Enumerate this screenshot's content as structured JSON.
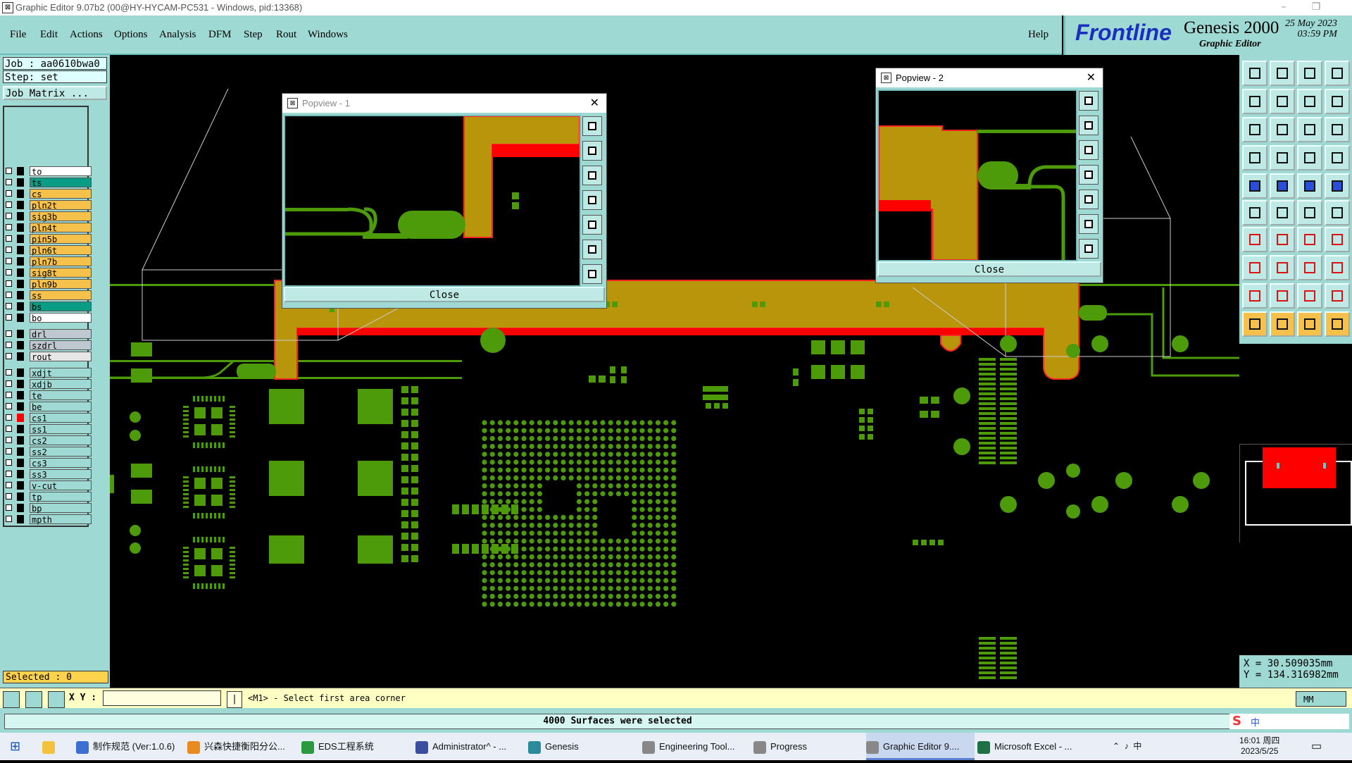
{
  "window": {
    "title": "Graphic Editor 9.07b2 (00@HY-HYCAM-PC531 - Windows, pid:13368)"
  },
  "menu": [
    "File",
    "Edit",
    "Actions",
    "Options",
    "Analysis",
    "DFM",
    "Step",
    "Rout",
    "Windows"
  ],
  "help_label": "Help",
  "brand": {
    "logo": "Frontline",
    "product": "Genesis 2000",
    "subtitle": "Graphic Editor",
    "date": "25 May 2023",
    "time": "03:59 PM"
  },
  "job": {
    "job_label": "Job : aa0610bwa0",
    "step_label": "Step: set",
    "matrix_button": "Job Matrix ..."
  },
  "layers": [
    {
      "name": "to",
      "color": "#ffffff"
    },
    {
      "name": "ts",
      "color": "#0a9d86"
    },
    {
      "name": "cs",
      "color": "#f5c14a"
    },
    {
      "name": "pln2t",
      "color": "#f5c14a"
    },
    {
      "name": "sig3b",
      "color": "#f5c14a"
    },
    {
      "name": "pln4t",
      "color": "#f5c14a"
    },
    {
      "name": "pin5b",
      "color": "#f5c14a"
    },
    {
      "name": "pln6t",
      "color": "#f5c14a"
    },
    {
      "name": "pln7b",
      "color": "#f5c14a"
    },
    {
      "name": "sig8t",
      "color": "#f5c14a"
    },
    {
      "name": "pln9b",
      "color": "#f5c14a"
    },
    {
      "name": "ss",
      "color": "#f5c14a"
    },
    {
      "name": "bs",
      "color": "#0a9d86"
    },
    {
      "name": "bo",
      "color": "#ffffff"
    },
    {
      "name": "drl",
      "color": "#bfc8d0"
    },
    {
      "name": "szdrl",
      "color": "#bfc8d0"
    },
    {
      "name": "rout",
      "color": "#e6e6e6"
    },
    {
      "name": "xdjt",
      "color": "#9fd9d4"
    },
    {
      "name": "xdjb",
      "color": "#9fd9d4"
    },
    {
      "name": "te",
      "color": "#9fd9d4"
    },
    {
      "name": "be",
      "color": "#9fd9d4"
    },
    {
      "name": "cs1",
      "color": "#9fd9d4"
    },
    {
      "name": "ss1",
      "color": "#9fd9d4"
    },
    {
      "name": "cs2",
      "color": "#9fd9d4"
    },
    {
      "name": "ss2",
      "color": "#9fd9d4"
    },
    {
      "name": "cs3",
      "color": "#9fd9d4"
    },
    {
      "name": "ss3",
      "color": "#9fd9d4"
    },
    {
      "name": "v-cut",
      "color": "#9fd9d4"
    },
    {
      "name": "tp",
      "color": "#9fd9d4"
    },
    {
      "name": "bp",
      "color": "#9fd9d4"
    },
    {
      "name": "mpth",
      "color": "#9fd9d4"
    }
  ],
  "selected_label": "Selected : 0",
  "popview1": {
    "title": "Popview - 1",
    "close": "Close"
  },
  "popview2": {
    "title": "Popview - 2",
    "close": "Close"
  },
  "coords": {
    "x": "X =  30.509035mm",
    "y": "Y = 134.316982mm"
  },
  "cmd": {
    "xy_label": "X Y :",
    "prompt": "<M1> - Select first area corner",
    "units": "MM"
  },
  "status_message": "4000 Surfaces were selected",
  "taskbar": [
    {
      "label": "制作规范 (Ver:1.0.6)",
      "color": "#3b6fd1"
    },
    {
      "label": "兴森快捷衡阳分公...",
      "color": "#e98b1f"
    },
    {
      "label": "EDS工程系统",
      "color": "#2b9a3f"
    },
    {
      "label": "Administrator^ - ...",
      "color": "#3b4fa0"
    },
    {
      "label": "Genesis",
      "color": "#2a8c9a"
    },
    {
      "label": "Engineering Tool...",
      "color": "#888888"
    },
    {
      "label": "Progress",
      "color": "#888888"
    },
    {
      "label": "Graphic Editor 9....",
      "color": "#888888"
    },
    {
      "label": "Microsoft Excel - ...",
      "color": "#1e7145"
    }
  ],
  "tray": {
    "ime": "中",
    "ime2": "中",
    "time": "16:01 周四",
    "date": "2023/5/25"
  },
  "colors": {
    "copper": "#4d9a0a",
    "plane": "#b8950b",
    "drill": "#ff0000",
    "panel": "#9fd9d4"
  }
}
